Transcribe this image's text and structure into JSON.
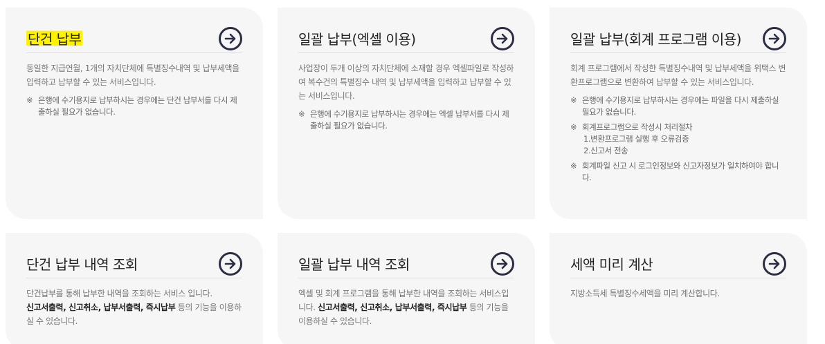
{
  "cards": [
    {
      "title": "단건 납부",
      "desc": "동일한 지급연월, 1개의 자치단체에 특별징수내역 및 납부세액을 입력하고 납부할 수 있는 서비스입니다.",
      "notes": [
        {
          "mark": "※",
          "text": "은행에 수기용지로 납부하시는 경우에는 단건 납부서를 다시 제출하실 필요가 없습니다."
        }
      ]
    },
    {
      "title": "일괄 납부(엑셀 이용)",
      "desc": "사업장이 두개 이상의 자치단체에 소재할 경우 엑셀파일로 작성하여 복수건의 특별징수 내역 및 납부세액을 입력하고 납부할 수 있는 서비스입니다.",
      "notes": [
        {
          "mark": "※",
          "text": "은행에 수기용지로 납부하시는 경우에는 엑셀 납부서를 다시 제출하실 필요가 없습니다."
        }
      ]
    },
    {
      "title": "일괄 납부(회계 프로그램 이용)",
      "desc": "회계 프로그램에서 작성한 특별징수내역 및 납부세액을 위택스 변환프로그램으로 변환하여 납부할 수 있는 서비스입니다.",
      "notes": [
        {
          "mark": "※",
          "text": "은행에 수기용지로 납부하시는 경우에는 파일을 다시 제출하실 필요가 없습니다."
        },
        {
          "mark": "※",
          "text": "회계프로그램으로 작성시 처리절차",
          "sub1": "1.변환프로그램 실행 후 오류검증",
          "sub2": "2.신고서 전송"
        },
        {
          "mark": "※",
          "text": "회계파일 신고 시 로그인정보와 신고자정보가 일치하여야 합니다."
        }
      ]
    },
    {
      "title": "단건 납부 내역 조회",
      "desc_pre": "단건납부를 통해 납부한 내역을 조회하는 서비스 입니다.",
      "desc_bold": "신고서출력, 신고취소, 납부서출력, 즉시납부",
      "desc_post": " 등의 기능을 이용하실 수 있습니다."
    },
    {
      "title": "일괄 납부 내역 조회",
      "desc_pre": "엑셀 및 회계 프로그램을 통해 납부한 내역을 조회하는 서비스입니다. ",
      "desc_bold": "신고서출력, 신고취소, 납부서출력, 즉시납부",
      "desc_post": " 등의 기능을 이용하실 수 있습니다."
    },
    {
      "title": "세액 미리 계산",
      "desc": "지방소득세 특별징수세액을 미리 계산합니다."
    }
  ],
  "icons": {
    "go": "arrow-right-circle-icon"
  },
  "colors": {
    "card_bg": "#f6f6f6",
    "highlight": "#fff200",
    "icon": "#2b2d42"
  }
}
